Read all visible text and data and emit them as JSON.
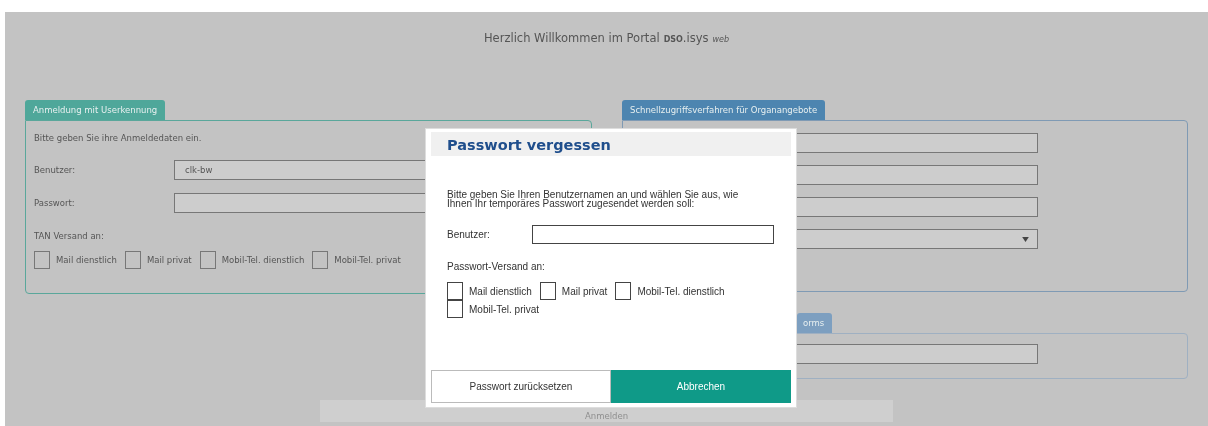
{
  "header": {
    "title": "Herzlich Willkommen im Portal",
    "brand": "**DSO**.isys",
    "edition": "web"
  },
  "login_panel": {
    "tab": "Anmeldung mit Userkennung",
    "intro": "Bitte geben Sie ihre Anmeldedaten ein.",
    "fields": [
      {
        "label": "Benutzer:",
        "value": "clk-bw"
      },
      {
        "label": "Passwort:"
      }
    ],
    "tan_label": "TAN Versand an:",
    "tan_options": [
      {
        "label": "Mail dienstlich",
        "checked": false
      },
      {
        "label": "Mail privat",
        "checked": false
      },
      {
        "label": "Mobil-Tel. dienstlich",
        "checked": false
      },
      {
        "label": "Mobil-Tel. privat",
        "checked": false
      }
    ]
  },
  "quick_access_panel": {
    "tab": "Schnellzugriffsverfahren für Organangebote",
    "fields": [
      {
        "kind": "text"
      },
      {
        "kind": "text"
      },
      {
        "kind": "text"
      },
      {
        "kind": "select"
      }
    ]
  },
  "second_panel": {
    "tab": "orms"
  },
  "login_button": "Anmelden",
  "dialog": {
    "title": "Passwort vergessen",
    "instructions": "Bitte geben Sie Ihren Benutzernamen an und wählen Sie aus, wie Ihnen Ihr temporäres Passwort zugesendet werden soll:",
    "user_label": "Benutzer:",
    "delivery_label": "Passwort-Versand an:",
    "delivery_options": [
      {
        "label": "Mail dienstlich",
        "checked": false
      },
      {
        "label": "Mail privat",
        "checked": false
      },
      {
        "label": "Mobil-Tel. dienstlich",
        "checked": false
      },
      {
        "label": "Mobil-Tel. privat",
        "checked": false
      }
    ],
    "buttons": [
      {
        "label": "Passwort zurücksetzen",
        "kind": "secondary"
      },
      {
        "label": "Abbrechen",
        "kind": "primary"
      }
    ]
  }
}
